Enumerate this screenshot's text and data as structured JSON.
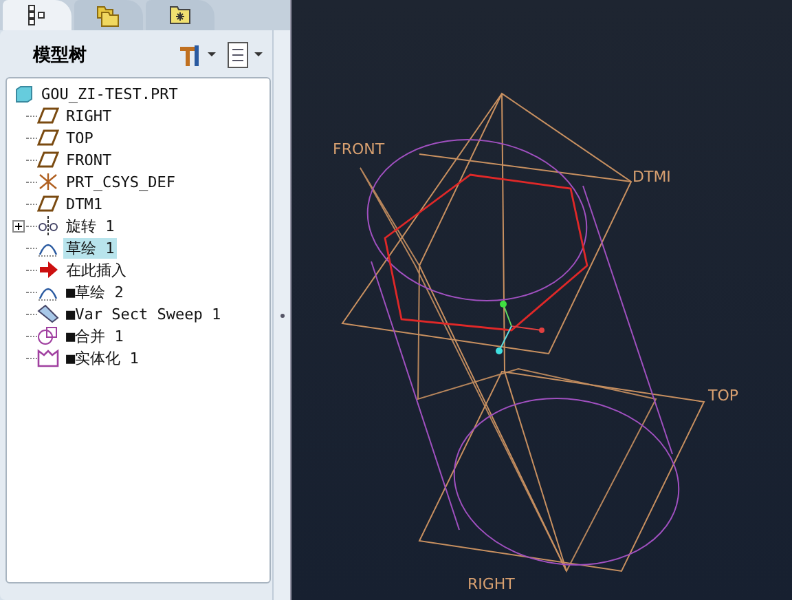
{
  "navigator_tabs": [
    {
      "kind": "tree",
      "selected": true
    },
    {
      "kind": "folders",
      "selected": false
    },
    {
      "kind": "favorites",
      "selected": false
    }
  ],
  "panel": {
    "title": "模型树"
  },
  "tree": {
    "label": "GOU_ZI-TEST.PRT",
    "kind": "part",
    "selected": false,
    "children": [
      {
        "label": "RIGHT",
        "kind": "plane",
        "selected": false
      },
      {
        "label": "TOP",
        "kind": "plane",
        "selected": false
      },
      {
        "label": "FRONT",
        "kind": "plane",
        "selected": false
      },
      {
        "label": "PRT_CSYS_DEF",
        "kind": "csys",
        "selected": false
      },
      {
        "label": "DTM1",
        "kind": "plane",
        "selected": false
      },
      {
        "label": "旋转 1",
        "kind": "revolve",
        "selected": false,
        "expanded": false
      },
      {
        "label": "草绘 1",
        "kind": "sketch",
        "selected": true
      },
      {
        "label": "在此插入",
        "kind": "insert",
        "selected": false
      },
      {
        "label": "■草绘 2",
        "kind": "sketch",
        "selected": false
      },
      {
        "label": "■Var Sect Sweep 1",
        "kind": "sweep",
        "selected": false
      },
      {
        "label": "■合并 1",
        "kind": "merge",
        "selected": false
      },
      {
        "label": "■实体化 1",
        "kind": "solidify",
        "selected": false
      }
    ]
  },
  "viewport": {
    "datum_labels": [
      {
        "label": "FRONT",
        "kind": "front"
      },
      {
        "label": "DTMI",
        "kind": "dtm"
      },
      {
        "label": "TOP",
        "kind": "top"
      },
      {
        "label": "RIGHT",
        "kind": "right"
      }
    ]
  }
}
